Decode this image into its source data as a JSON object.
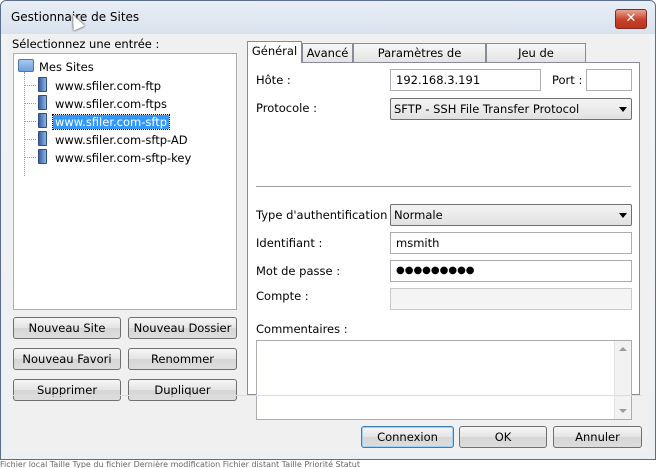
{
  "window": {
    "title": "Gestionnaire de Sites",
    "close_symbol": "✕"
  },
  "left": {
    "select_label": "Sélectionnez une entrée :",
    "tree": {
      "root": "Mes Sites",
      "items": [
        {
          "label": "www.sfiler.com-ftp",
          "selected": false
        },
        {
          "label": "www.sfiler.com-ftps",
          "selected": false
        },
        {
          "label": "www.sfiler.com-sftp",
          "selected": true
        },
        {
          "label": "www.sfiler.com-sftp-AD",
          "selected": false
        },
        {
          "label": "www.sfiler.com-sftp-key",
          "selected": false
        }
      ]
    },
    "buttons": {
      "new_site": "Nouveau Site",
      "new_folder": "Nouveau Dossier",
      "new_bookmark": "Nouveau Favori",
      "rename": "Renommer",
      "delete": "Supprimer",
      "duplicate": "Dupliquer"
    }
  },
  "tabs": [
    {
      "label": "Général",
      "active": true
    },
    {
      "label": "Avancé",
      "active": false
    },
    {
      "label": "Paramètres de transfert",
      "active": false
    },
    {
      "label": "Jeu de caractères",
      "active": false
    }
  ],
  "general": {
    "host_label": "Hôte :",
    "host_value": "192.168.3.191",
    "port_label": "Port :",
    "port_value": "",
    "protocol_label": "Protocole :",
    "protocol_value": "SFTP - SSH File Transfer Protocol",
    "auth_label": "Type d'authentification :",
    "auth_value": "Normale",
    "user_label": "Identifiant :",
    "user_value": "msmith",
    "password_label": "Mot de passe :",
    "password_value": "●●●●●●●●●",
    "account_label": "Compte :",
    "account_value": "",
    "comments_label": "Commentaires :",
    "comments_value": ""
  },
  "footer": {
    "connect": "Connexion",
    "ok": "OK",
    "cancel": "Annuler"
  },
  "background_text": "Fichier local     Taille     Type du fichier     Dernière modification     Fichier distant     Taille     Priorité     Statut"
}
